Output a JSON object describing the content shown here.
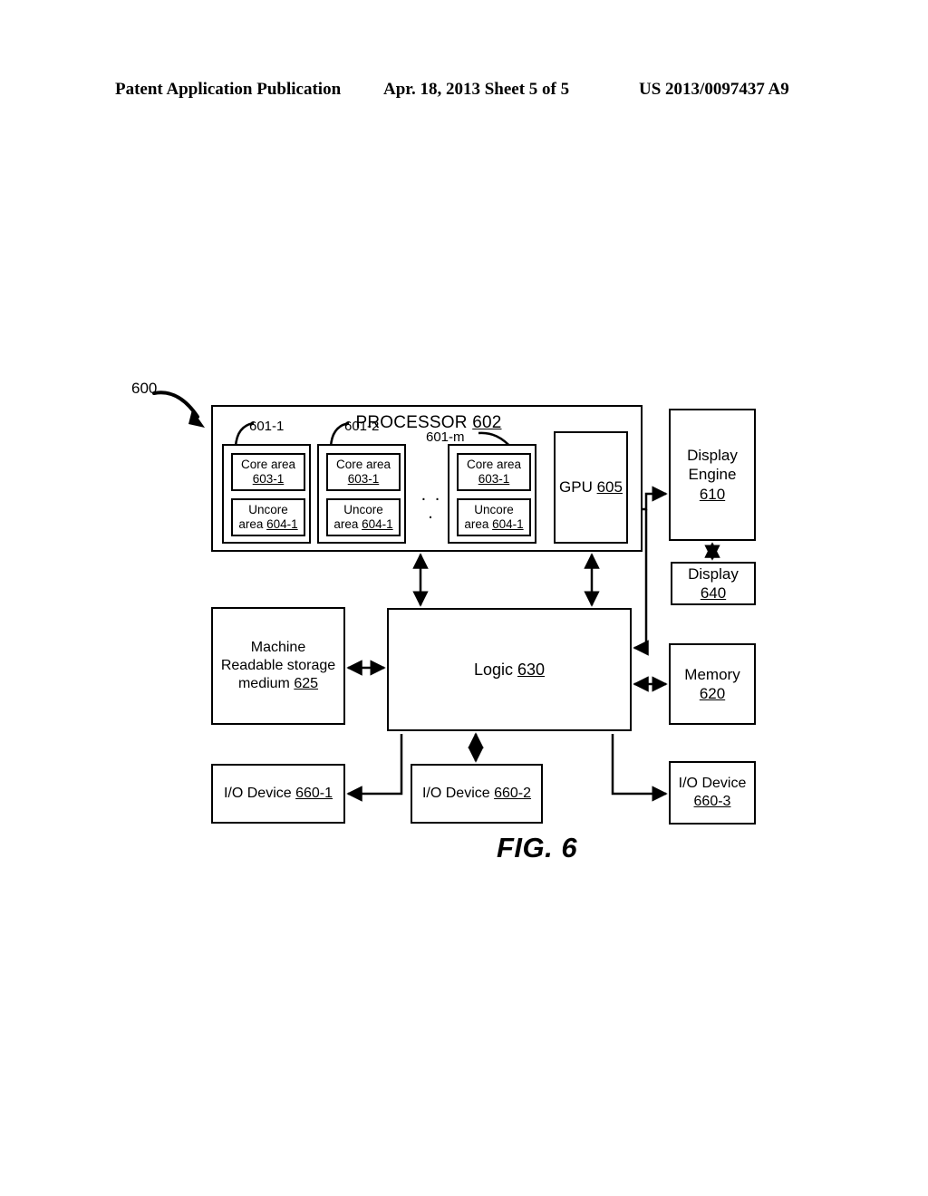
{
  "header": {
    "left": "Patent Application Publication",
    "middle": "Apr. 18, 2013  Sheet 5 of 5",
    "right": "US 2013/0097437 A9"
  },
  "figure": {
    "caption": "FIG. 6",
    "system_ref": "600",
    "processor": {
      "title_text": "PROCESSOR",
      "title_ref": "602",
      "lead_labels": [
        "601-1",
        "601-2",
        "601-m"
      ],
      "ellipsis": ". . .",
      "cores": [
        {
          "core_label": "Core area",
          "core_ref": "603-1",
          "uncore_label": "Uncore",
          "uncore_prefix": "area",
          "uncore_ref": "604-1"
        },
        {
          "core_label": "Core area",
          "core_ref": "603-1",
          "uncore_label": "Uncore",
          "uncore_prefix": "area",
          "uncore_ref": "604-1"
        },
        {
          "core_label": "Core area",
          "core_ref": "603-1",
          "uncore_label": "Uncore",
          "uncore_prefix": "area",
          "uncore_ref": "604-1"
        }
      ],
      "gpu": {
        "label": "GPU",
        "ref": "605"
      }
    },
    "blocks": {
      "display_engine": {
        "line1": "Display",
        "line2": "Engine",
        "ref": "610"
      },
      "display": {
        "line1": "Display",
        "ref": "640"
      },
      "memory": {
        "line1": "Memory",
        "ref": "620"
      },
      "machine_readable_storage_medium": {
        "line1": "Machine",
        "line2": "Readable storage",
        "line3": "medium",
        "ref": "625"
      },
      "logic": {
        "label": "Logic",
        "ref": "630"
      },
      "io_device_1": {
        "label": "I/O Device",
        "ref": "660-1"
      },
      "io_device_2": {
        "label": "I/O Device",
        "ref": "660-2"
      },
      "io_device_3": {
        "label": "I/O Device",
        "ref": "660-3"
      }
    },
    "colors": {
      "stroke": "#000000",
      "background": "#ffffff"
    }
  }
}
